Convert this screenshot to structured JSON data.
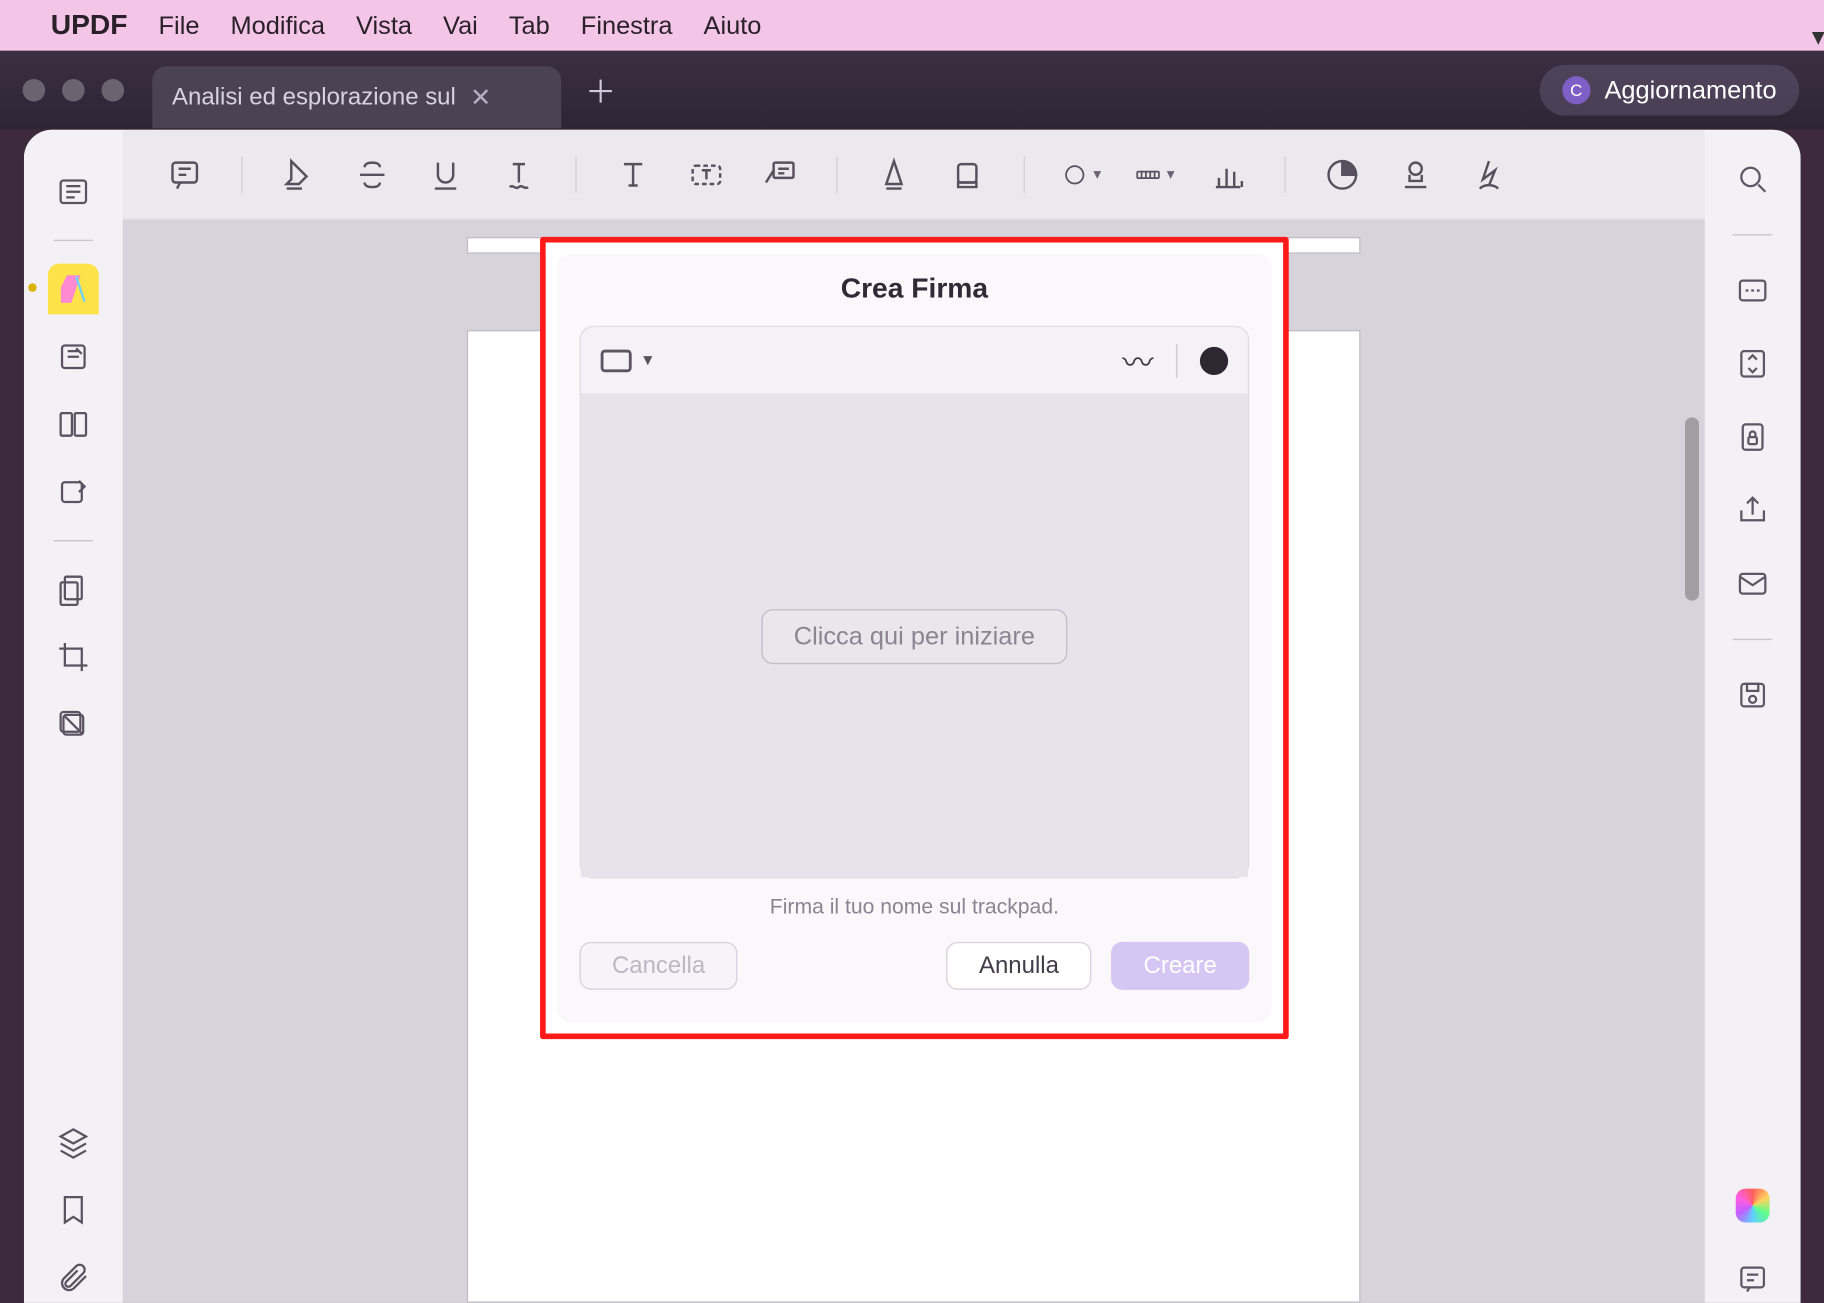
{
  "menubar": {
    "app": "UPDF",
    "items": [
      "File",
      "Modifica",
      "Vista",
      "Vai",
      "Tab",
      "Finestra",
      "Aiuto"
    ]
  },
  "tab": {
    "title": "Analisi ed esplorazione sul"
  },
  "update": {
    "initial": "C",
    "label": "Aggiornamento"
  },
  "dialog": {
    "title": "Crea Firma",
    "start": "Clicca qui per iniziare",
    "hint": "Firma il tuo nome sul trackpad.",
    "cancella": "Cancella",
    "annulla": "Annulla",
    "creare": "Creare"
  }
}
